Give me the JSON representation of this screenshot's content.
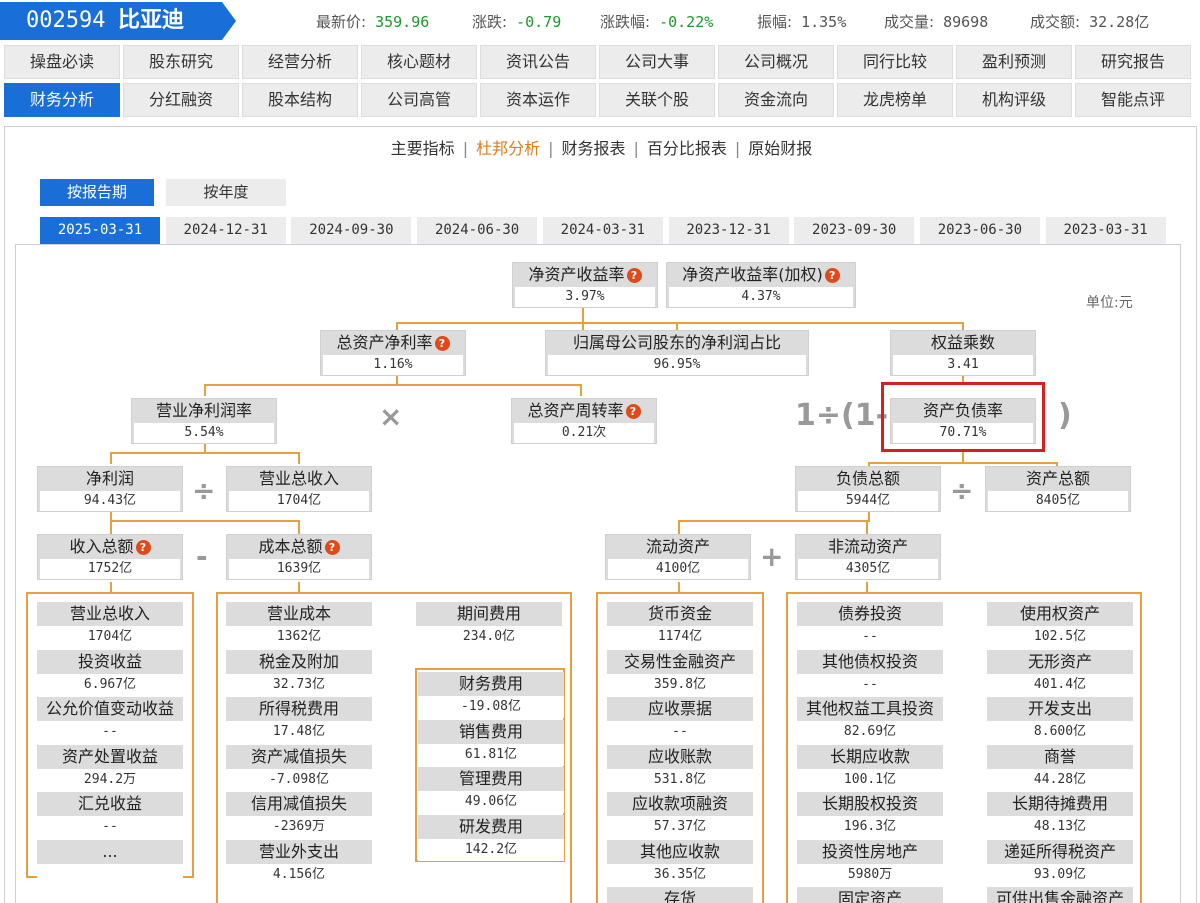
{
  "stock": {
    "code": "002594",
    "name": "比亚迪"
  },
  "quotes": [
    {
      "label": "最新价:",
      "value": "359.96",
      "color": "#1a9a2a"
    },
    {
      "label": "涨跌:",
      "value": "-0.79",
      "color": "#1a9a2a"
    },
    {
      "label": "涨跌幅:",
      "value": "-0.22%",
      "color": "#1a9a2a"
    },
    {
      "label": "振幅:",
      "value": "1.35%",
      "color": "#555555"
    },
    {
      "label": "成交量:",
      "value": "89698",
      "color": "#555555"
    },
    {
      "label": "成交额:",
      "value": "32.28亿",
      "color": "#555555"
    }
  ],
  "nav_row1": [
    "操盘必读",
    "股东研究",
    "经营分析",
    "核心题材",
    "资讯公告",
    "公司大事",
    "公司概况",
    "同行比较",
    "盈利预测",
    "研究报告"
  ],
  "nav_row2": [
    "财务分析",
    "分红融资",
    "股本结构",
    "公司高管",
    "资本运作",
    "关联个股",
    "资金流向",
    "龙虎榜单",
    "机构评级",
    "智能点评"
  ],
  "subnav": [
    "主要指标",
    "杜邦分析",
    "财务报表",
    "百分比报表",
    "原始财报"
  ],
  "modes": [
    "按报告期",
    "按年度"
  ],
  "dates": [
    "2025-03-31",
    "2024-12-31",
    "2024-09-30",
    "2024-06-30",
    "2024-03-31",
    "2023-12-31",
    "2023-09-30",
    "2023-06-30",
    "2023-03-31"
  ],
  "unit": "单位:元",
  "formula": "1÷(1-",
  "formula_close": ")",
  "tree": {
    "roe": {
      "label": "净资产收益率",
      "value": "3.97%"
    },
    "roe_weighted": {
      "label": "净资产收益率(加权)",
      "value": "4.37%"
    },
    "roa": {
      "label": "总资产净利率",
      "value": "1.16%"
    },
    "parent_ratio": {
      "label": "归属母公司股东的净利润占比",
      "value": "96.95%"
    },
    "equity_mult": {
      "label": "权益乘数",
      "value": "3.41"
    },
    "net_margin": {
      "label": "营业净利润率",
      "value": "5.54%"
    },
    "asset_turnover": {
      "label": "总资产周转率",
      "value": "0.21次"
    },
    "debt_ratio": {
      "label": "资产负债率",
      "value": "70.71%"
    },
    "net_profit": {
      "label": "净利润",
      "value": "94.43亿"
    },
    "revenue": {
      "label": "营业总收入",
      "value": "1704亿"
    },
    "liabilities": {
      "label": "负债总额",
      "value": "5944亿"
    },
    "total_assets": {
      "label": "资产总额",
      "value": "8405亿"
    },
    "income_total": {
      "label": "收入总额",
      "value": "1752亿"
    },
    "cost_total": {
      "label": "成本总额",
      "value": "1639亿"
    },
    "current_assets": {
      "label": "流动资产",
      "value": "4100亿"
    },
    "noncurrent_assets": {
      "label": "非流动资产",
      "value": "4305亿"
    }
  },
  "income_items": [
    {
      "label": "营业总收入",
      "value": "1704亿"
    },
    {
      "label": "投资收益",
      "value": "6.967亿"
    },
    {
      "label": "公允价值变动收益",
      "value": "--"
    },
    {
      "label": "资产处置收益",
      "value": "294.2万"
    },
    {
      "label": "汇兑收益",
      "value": "--"
    },
    {
      "label": "...",
      "value": ""
    }
  ],
  "cost_items": [
    {
      "label": "营业成本",
      "value": "1362亿"
    },
    {
      "label": "税金及附加",
      "value": "32.73亿"
    },
    {
      "label": "所得税费用",
      "value": "17.48亿"
    },
    {
      "label": "资产减值损失",
      "value": "-7.098亿"
    },
    {
      "label": "信用减值损失",
      "value": "-2369万"
    },
    {
      "label": "营业外支出",
      "value": "4.156亿"
    }
  ],
  "period_expense": {
    "label": "期间费用",
    "value": "234.0亿"
  },
  "expense_items": [
    {
      "label": "财务费用",
      "value": "-19.08亿"
    },
    {
      "label": "销售费用",
      "value": "61.81亿"
    },
    {
      "label": "管理费用",
      "value": "49.06亿"
    },
    {
      "label": "研发费用",
      "value": "142.2亿"
    }
  ],
  "current_items": [
    {
      "label": "货币资金",
      "value": "1174亿"
    },
    {
      "label": "交易性金融资产",
      "value": "359.8亿"
    },
    {
      "label": "应收票据",
      "value": "--"
    },
    {
      "label": "应收账款",
      "value": "531.8亿"
    },
    {
      "label": "应收款项融资",
      "value": "57.37亿"
    },
    {
      "label": "其他应收款",
      "value": "36.35亿"
    },
    {
      "label": "存货",
      "value": ""
    }
  ],
  "noncurrent_items_left": [
    {
      "label": "债券投资",
      "value": "--"
    },
    {
      "label": "其他债权投资",
      "value": "--"
    },
    {
      "label": "其他权益工具投资",
      "value": "82.69亿"
    },
    {
      "label": "长期应收款",
      "value": "100.1亿"
    },
    {
      "label": "长期股权投资",
      "value": "196.3亿"
    },
    {
      "label": "投资性房地产",
      "value": "5980万"
    },
    {
      "label": "固定资产",
      "value": ""
    }
  ],
  "noncurrent_items_right": [
    {
      "label": "使用权资产",
      "value": "102.5亿"
    },
    {
      "label": "无形资产",
      "value": "401.4亿"
    },
    {
      "label": "开发支出",
      "value": "8.600亿"
    },
    {
      "label": "商誉",
      "value": "44.28亿"
    },
    {
      "label": "长期待摊费用",
      "value": "48.13亿"
    },
    {
      "label": "递延所得税资产",
      "value": "93.09亿"
    },
    {
      "label": "可供出售金融资产",
      "value": ""
    }
  ],
  "ops": {
    "times": "×",
    "divide": "÷",
    "minus": "-",
    "plus": "+"
  },
  "help_glyph": "?"
}
